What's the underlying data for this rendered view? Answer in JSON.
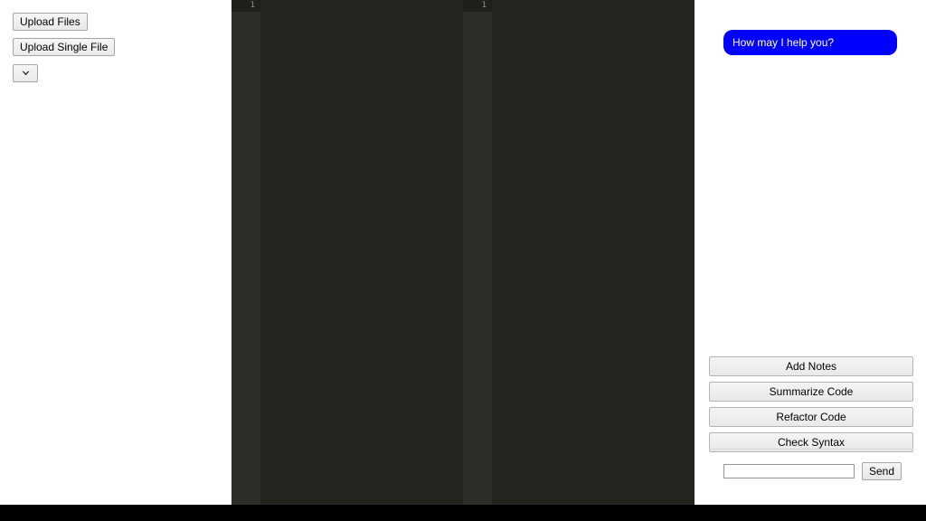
{
  "sidebar": {
    "upload_files_label": "Upload Files",
    "upload_single_file_label": "Upload Single File",
    "file_select": {
      "selected_value": "",
      "chevron_icon": "chevron-down-icon"
    }
  },
  "editors": [
    {
      "name": "code-editor-left",
      "line_numbers": [
        "1"
      ],
      "lines": [
        ""
      ],
      "theme": {
        "background": "#24251f",
        "gutter_background": "#2d2e27",
        "active_line_background": "#1f2019",
        "line_number_color": "#8f9184",
        "cursor_color": "#6f7166"
      }
    },
    {
      "name": "code-editor-right",
      "line_numbers": [
        "1"
      ],
      "lines": [
        ""
      ],
      "theme": {
        "background": "#24251f",
        "gutter_background": "#2d2e27",
        "active_line_background": "#1f2019",
        "line_number_color": "#8f9184",
        "cursor_color": "#6f7166"
      }
    }
  ],
  "chat": {
    "messages": [
      {
        "role": "assistant",
        "text": "How may I help you?",
        "bubble_color": "#0000ff",
        "text_color": "#ffffff"
      }
    ],
    "actions": [
      {
        "label": "Add Notes"
      },
      {
        "label": "Summarize Code"
      },
      {
        "label": "Refactor Code"
      },
      {
        "label": "Check Syntax"
      }
    ],
    "input": {
      "value": "",
      "placeholder": ""
    },
    "send_label": "Send"
  },
  "colors": {
    "accent_blue": "#0000ff",
    "page_background": "#ffffff",
    "bottom_bar": "#000000"
  }
}
